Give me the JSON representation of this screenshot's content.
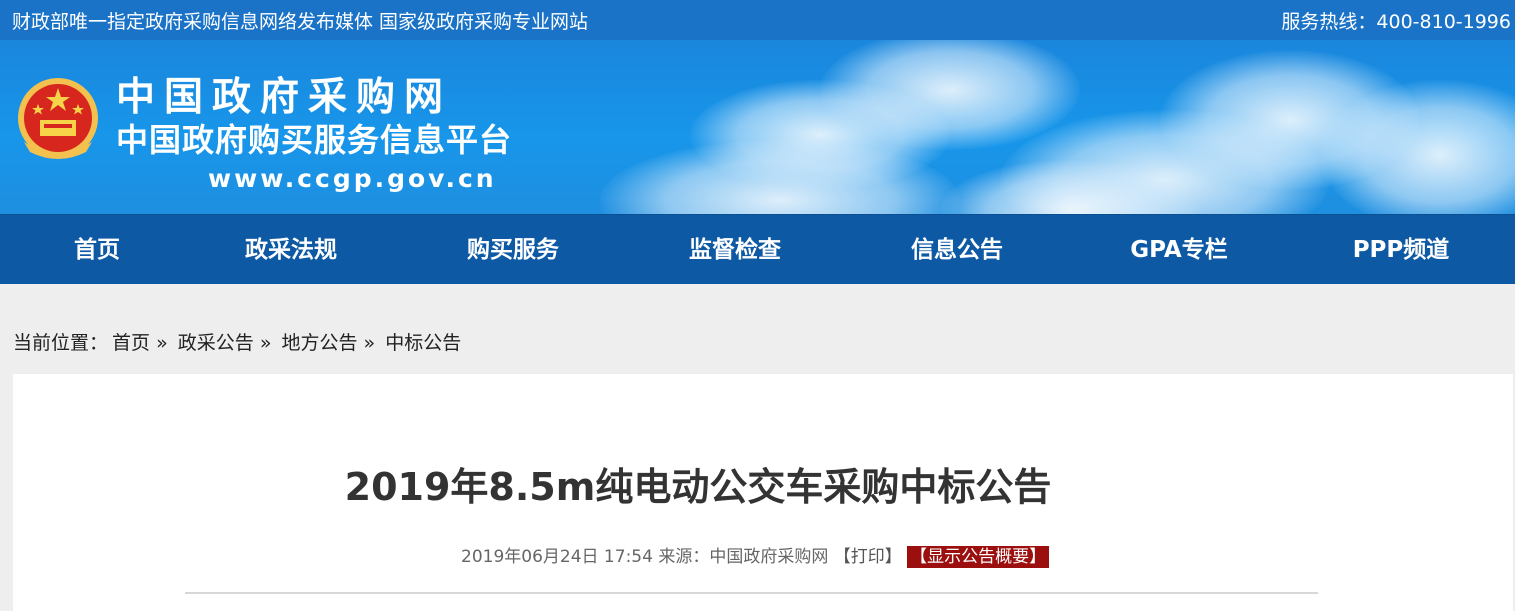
{
  "topbar": {
    "slogan": "财政部唯一指定政府采购信息网络发布媒体 国家级政府采购专业网站",
    "hotline": "服务热线：400-810-1996"
  },
  "banner": {
    "logo_line1": "中国政府采购网",
    "logo_line2": "中国政府购买服务信息平台",
    "logo_url": "www.ccgp.gov.cn"
  },
  "nav": {
    "items": [
      {
        "label": "首页"
      },
      {
        "label": "政采法规"
      },
      {
        "label": "购买服务"
      },
      {
        "label": "监督检查"
      },
      {
        "label": "信息公告"
      },
      {
        "label": "GPA专栏"
      },
      {
        "label": "PPP频道"
      }
    ]
  },
  "breadcrumb": {
    "prefix": "当前位置：",
    "items": [
      "首页",
      "政采公告",
      "地方公告",
      "中标公告"
    ],
    "separator": "»"
  },
  "article": {
    "title": "2019年8.5m纯电动公交车采购中标公告",
    "date": "2019年06月24日 17:54",
    "source_label": "来源：",
    "source": "中国政府采购网",
    "print_label": "【打印】",
    "summary_label": "【显示公告概要】"
  },
  "colors": {
    "topbar": "#1a73c7",
    "nav": "#0e59a4",
    "summary_badge": "#9b0f0f"
  }
}
